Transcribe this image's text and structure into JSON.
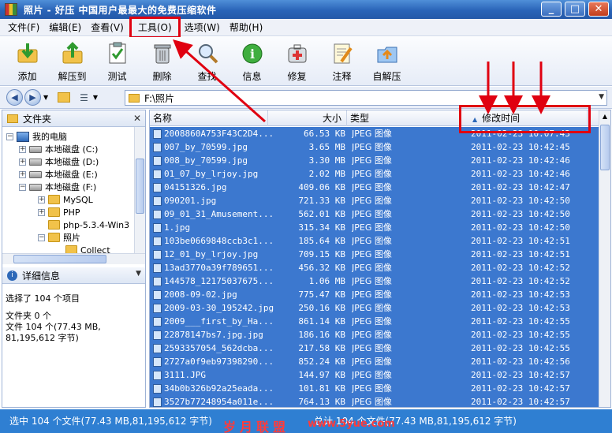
{
  "window": {
    "title": "照片 - 好压 中国用户最最大的免费压缩软件",
    "buttons": [
      "_",
      "□",
      "✕"
    ]
  },
  "menu": [
    "文件(F)",
    "编辑(E)",
    "查看(V)",
    "工具(O)",
    "选项(W)",
    "帮助(H)"
  ],
  "toolbar": [
    {
      "label": "添加",
      "icon": "add-icon"
    },
    {
      "label": "解压到",
      "icon": "extract-icon"
    },
    {
      "label": "测试",
      "icon": "test-icon"
    },
    {
      "label": "删除",
      "icon": "trash-icon"
    },
    {
      "label": "查找",
      "icon": "magnifier-icon"
    },
    {
      "label": "信息",
      "icon": "info-icon"
    },
    {
      "label": "修复",
      "icon": "repair-icon"
    },
    {
      "label": "注释",
      "icon": "comment-icon"
    },
    {
      "label": "自解压",
      "icon": "sfx-icon"
    }
  ],
  "address": {
    "path": "F:\\照片"
  },
  "folders": {
    "header": "文件夹",
    "tree": [
      {
        "label": "我的电脑",
        "icon": "computer",
        "expander": "-"
      },
      {
        "label": "本地磁盘 (C:)",
        "icon": "drive",
        "expander": "+"
      },
      {
        "label": "本地磁盘 (D:)",
        "icon": "drive",
        "expander": "+"
      },
      {
        "label": "本地磁盘 (E:)",
        "icon": "drive",
        "expander": "+"
      },
      {
        "label": "本地磁盘 (F:)",
        "icon": "drive",
        "expander": "-"
      },
      {
        "label": "MySQL",
        "icon": "folder",
        "expander": "+"
      },
      {
        "label": "PHP",
        "icon": "folder",
        "expander": "+"
      },
      {
        "label": "php-5.3.4-Win3",
        "icon": "folder",
        "expander": ""
      },
      {
        "label": "照片",
        "icon": "folder",
        "expander": "-"
      },
      {
        "label": "Collect",
        "icon": "folder",
        "expander": ""
      }
    ]
  },
  "details": {
    "header": "详细信息",
    "line1": "选择了 104 个项目",
    "line2": "文件夹 0 个",
    "line3": "文件 104 个(77.43 MB,",
    "line4": "81,195,612 字节)"
  },
  "columns": {
    "name": "名称",
    "size": "大小",
    "type": "类型",
    "time": "修改时间"
  },
  "files": [
    {
      "name": "2008860A753F43C2D4...",
      "size": "66.53 KB",
      "type": "JPEG 图像",
      "time": "2011-02-23 10:07:43"
    },
    {
      "name": "007_by_70599.jpg",
      "size": "3.65 MB",
      "type": "JPEG 图像",
      "time": "2011-02-23 10:42:45"
    },
    {
      "name": "008_by_70599.jpg",
      "size": "3.30 MB",
      "type": "JPEG 图像",
      "time": "2011-02-23 10:42:46"
    },
    {
      "name": "01_07_by_lrjoy.jpg",
      "size": "2.02 MB",
      "type": "JPEG 图像",
      "time": "2011-02-23 10:42:46"
    },
    {
      "name": "04151326.jpg",
      "size": "409.06 KB",
      "type": "JPEG 图像",
      "time": "2011-02-23 10:42:47"
    },
    {
      "name": "090201.jpg",
      "size": "721.33 KB",
      "type": "JPEG 图像",
      "time": "2011-02-23 10:42:50"
    },
    {
      "name": "09_01_31_Amusement...",
      "size": "562.01 KB",
      "type": "JPEG 图像",
      "time": "2011-02-23 10:42:50"
    },
    {
      "name": "1.jpg",
      "size": "315.34 KB",
      "type": "JPEG 图像",
      "time": "2011-02-23 10:42:50"
    },
    {
      "name": "103be0669848ccb3c1...",
      "size": "185.64 KB",
      "type": "JPEG 图像",
      "time": "2011-02-23 10:42:51"
    },
    {
      "name": "12_01_by_lrjoy.jpg",
      "size": "709.15 KB",
      "type": "JPEG 图像",
      "time": "2011-02-23 10:42:51"
    },
    {
      "name": "13ad3770a39f789651...",
      "size": "456.32 KB",
      "type": "JPEG 图像",
      "time": "2011-02-23 10:42:52"
    },
    {
      "name": "144578_12175037675...",
      "size": "1.06 MB",
      "type": "JPEG 图像",
      "time": "2011-02-23 10:42:52"
    },
    {
      "name": "2008-09-02.jpg",
      "size": "775.47 KB",
      "type": "JPEG 图像",
      "time": "2011-02-23 10:42:53"
    },
    {
      "name": "2009-03-30_195242.jpg",
      "size": "250.16 KB",
      "type": "JPEG 图像",
      "time": "2011-02-23 10:42:53"
    },
    {
      "name": "2009___first_by_Ha...",
      "size": "861.14 KB",
      "type": "JPEG 图像",
      "time": "2011-02-23 10:42:55"
    },
    {
      "name": "22878147bs7.jpg.jpg",
      "size": "186.16 KB",
      "type": "JPEG 图像",
      "time": "2011-02-23 10:42:55"
    },
    {
      "name": "2593357054_562dcba...",
      "size": "217.58 KB",
      "type": "JPEG 图像",
      "time": "2011-02-23 10:42:55"
    },
    {
      "name": "2727a0f9eb97398290...",
      "size": "852.24 KB",
      "type": "JPEG 图像",
      "time": "2011-02-23 10:42:56"
    },
    {
      "name": "3111.JPG",
      "size": "144.97 KB",
      "type": "JPEG 图像",
      "time": "2011-02-23 10:42:57"
    },
    {
      "name": "34b0b326b92a25eada...",
      "size": "101.81 KB",
      "type": "JPEG 图像",
      "time": "2011-02-23 10:42:57"
    },
    {
      "name": "3527b77248954a011e...",
      "size": "764.13 KB",
      "type": "JPEG 图像",
      "time": "2011-02-23 10:42:57"
    }
  ],
  "status": {
    "left": "选中 104 个文件(77.43 MB,81,195,612 字节)",
    "right": "总计 104 个文件(77.43 MB,81,195,612 字节)",
    "watermark": "岁月联盟",
    "watermark_url": "www.5yue.com"
  },
  "colors": {
    "selection": "#3c78cf",
    "annotation": "#e00010",
    "titlebar": "#2a64b8"
  }
}
